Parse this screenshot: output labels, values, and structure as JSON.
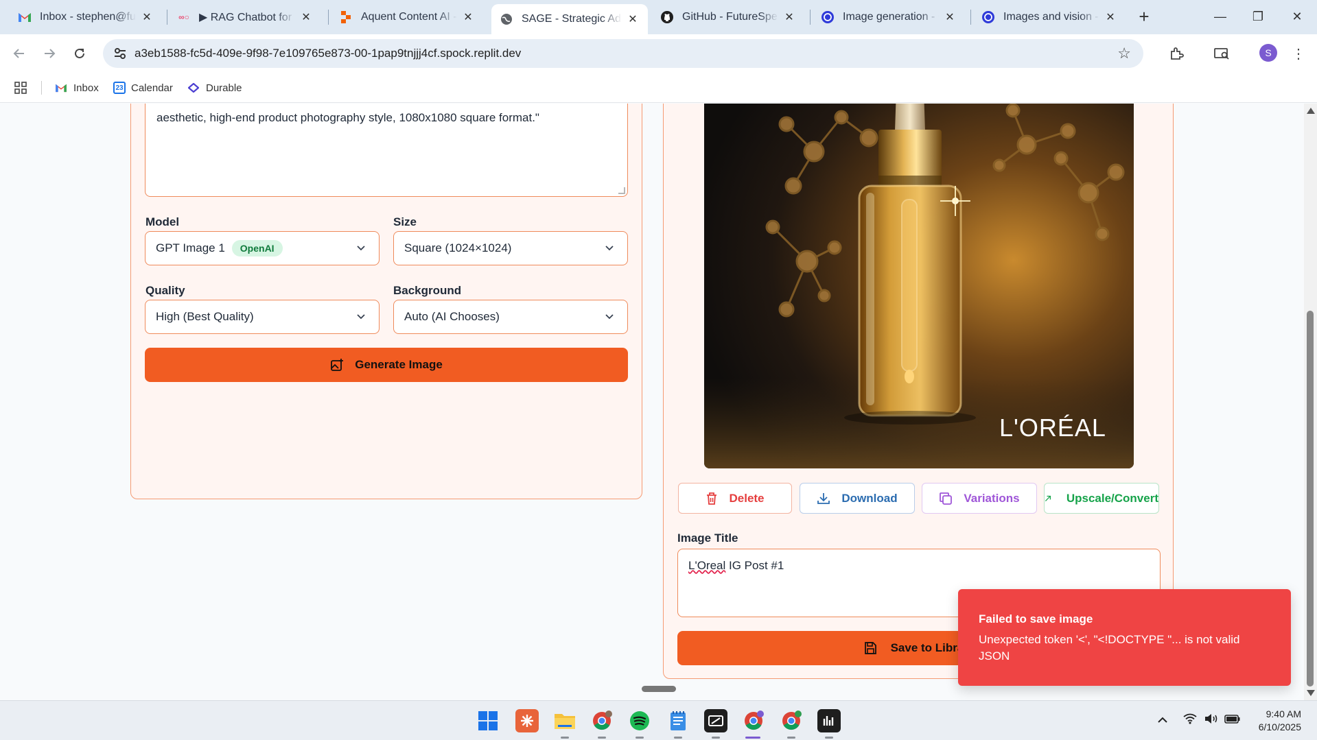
{
  "browser": {
    "tabs": [
      {
        "title": "Inbox - stephen@futu",
        "icon": "gmail-icon"
      },
      {
        "title": "▶ RAG Chatbot for Co",
        "icon": "n8n-icon"
      },
      {
        "title": "Aquent Content AI - R",
        "icon": "replit-icon"
      },
      {
        "title": "SAGE - Strategic Adap",
        "icon": "globe-icon",
        "active": true
      },
      {
        "title": "GitHub - FutureSpeak",
        "icon": "github-icon"
      },
      {
        "title": "Image generation - O",
        "icon": "openai-icon"
      },
      {
        "title": "Images and vision - O",
        "icon": "openai-icon"
      }
    ],
    "url": "a3eb1588-fc5d-409e-9f98-7e109765e873-00-1pap9tnjjj4cf.spock.replit.dev",
    "profile_initial": "S",
    "bookmarks": [
      {
        "label": "Inbox",
        "icon": "gmail-icon"
      },
      {
        "label": "Calendar",
        "icon": "calendar-icon",
        "day": "23"
      },
      {
        "label": "Durable",
        "icon": "durable-icon"
      }
    ]
  },
  "form": {
    "prompt_text": "aesthetic, high-end product photography style, 1080x1080 square format.\"",
    "model_label": "Model",
    "model_value": "GPT Image 1",
    "model_badge": "OpenAI",
    "size_label": "Size",
    "size_value": "Square (1024×1024)",
    "quality_label": "Quality",
    "quality_value": "High (Best Quality)",
    "background_label": "Background",
    "background_value": "Auto (AI Chooses)",
    "generate_label": "Generate Image"
  },
  "result": {
    "image_logo_text": "L'ORÉAL",
    "actions": {
      "delete": "Delete",
      "download": "Download",
      "variations": "Variations",
      "upscale": "Upscale/Convert"
    },
    "title_label": "Image Title",
    "title_value_word": "L'Oreal",
    "title_value_rest": " IG Post #1",
    "save_label": "Save to Library"
  },
  "toast": {
    "title": "Failed to save image",
    "message": "Unexpected token '<', \"<!DOCTYPE \"... is not valid JSON"
  },
  "taskbar": {
    "time": "9:40 AM",
    "date": "6/10/2025"
  },
  "colors": {
    "accent": "#f15c22",
    "toast_bg": "#ef4444",
    "delete": "#e53e3e",
    "download": "#2b6cb0",
    "variations": "#9f56d8",
    "upscale": "#16a34a"
  }
}
